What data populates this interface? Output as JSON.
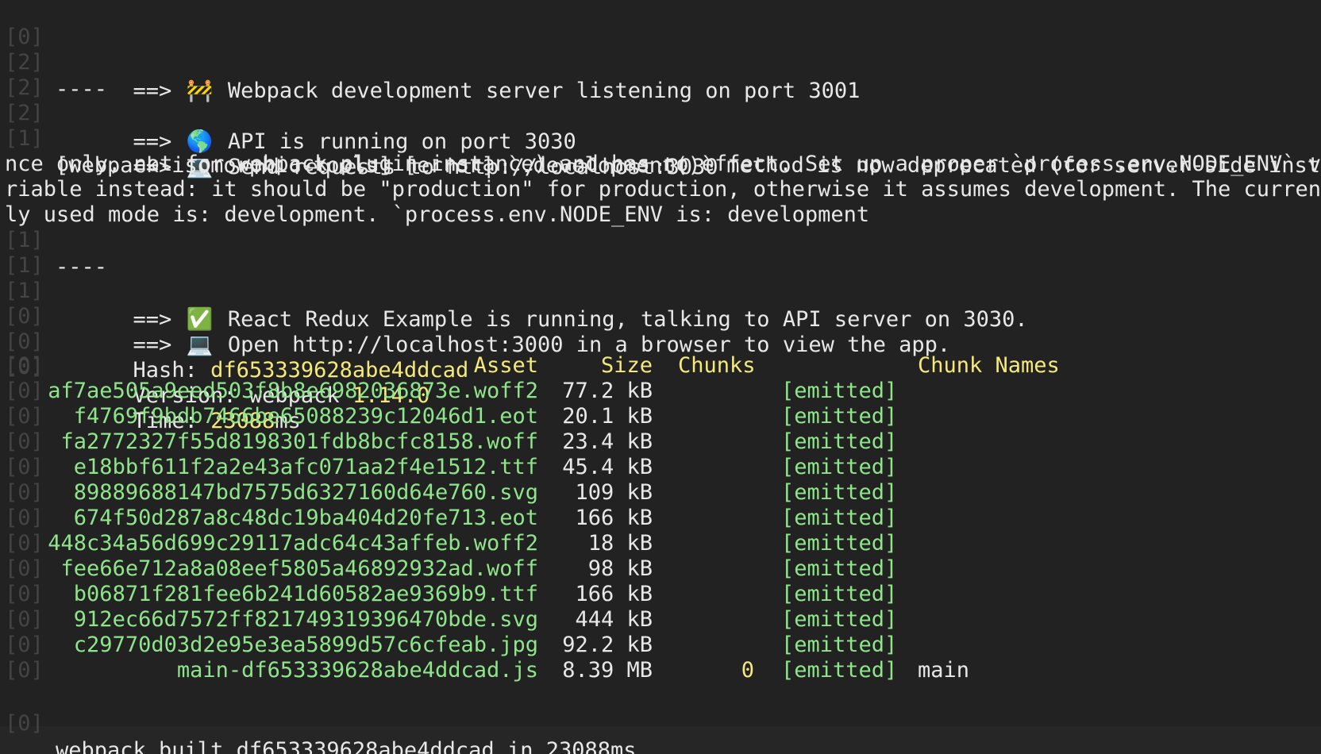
{
  "prefixes": [
    "[0]",
    "[2]",
    "[2]",
    "[2]",
    "[1]",
    "[1]",
    "[1]",
    "[1]",
    "[0]",
    "[0]",
    "[0]",
    "[0]",
    "[0]",
    "[0]",
    "[0]",
    "[0]",
    "[0]",
    "[0]",
    "[0]",
    "[0]",
    "[0]",
    "[0]",
    "[0]",
    "[0]",
    "[0]",
    "[0]",
    "[0]"
  ],
  "lines": {
    "webpack_server": "==> ",
    "webpack_server_emoji": "🚧",
    "webpack_server_text": " Webpack development server listening on port 3001",
    "sep1": "----",
    "api_running_prefix": "==> ",
    "api_running_emoji": "🌎",
    "api_running_text": " API is running on port 3030",
    "send_requests_prefix": "==> ",
    "send_requests_emoji": "💻",
    "send_requests_text": " Send requests to http://localhost:3030",
    "error_line1": "[webpack-isomorphic-tools] [error] `.development()` method is now deprecated (for server-side insta",
    "error_line2": "nce only, not for webpack plugin instance) and has no effect. Set up a proper `process.env.NODE_ENV` va",
    "error_line3": "riable instead: it should be \"production\" for production, otherwise it assumes development. The current",
    "error_line4": "ly used mode is: development. `process.env.NODE_ENV is: development",
    "sep2": "----",
    "react_prefix": "==> ",
    "react_emoji": "✅",
    "react_text": " React Redux Example is running, talking to API server on 3030.",
    "open_prefix": "==> ",
    "open_emoji": "💻",
    "open_text": " Open http://localhost:3000 in a browser to view the app.",
    "hash_label": "Hash: ",
    "hash_value": "df653339628abe4ddcad",
    "version_label": "Version: webpack ",
    "version_value": "1.14.0",
    "time_label": "Time: ",
    "time_value": "23088",
    "time_unit": "ms",
    "built": "webpack built df653339628abe4ddcad in 23088ms"
  },
  "table": {
    "headers": {
      "asset": "Asset",
      "size": "Size",
      "chunks": "Chunks",
      "chunk_names": "Chunk Names"
    },
    "rows": [
      {
        "asset": "af7ae505a9eed503f8b8e6982036873e.woff2",
        "size": "77.2 kB",
        "chunks": "",
        "status": "[emitted]",
        "names": ""
      },
      {
        "asset": "f4769f9bdb7466be65088239c12046d1.eot",
        "size": "20.1 kB",
        "chunks": "",
        "status": "[emitted]",
        "names": ""
      },
      {
        "asset": "fa2772327f55d8198301fdb8bcfc8158.woff",
        "size": "23.4 kB",
        "chunks": "",
        "status": "[emitted]",
        "names": ""
      },
      {
        "asset": "e18bbf611f2a2e43afc071aa2f4e1512.ttf",
        "size": "45.4 kB",
        "chunks": "",
        "status": "[emitted]",
        "names": ""
      },
      {
        "asset": "89889688147bd7575d6327160d64e760.svg",
        "size": "109 kB",
        "chunks": "",
        "status": "[emitted]",
        "names": ""
      },
      {
        "asset": "674f50d287a8c48dc19ba404d20fe713.eot",
        "size": "166 kB",
        "chunks": "",
        "status": "[emitted]",
        "names": ""
      },
      {
        "asset": "448c34a56d699c29117adc64c43affeb.woff2",
        "size": "18 kB",
        "chunks": "",
        "status": "[emitted]",
        "names": ""
      },
      {
        "asset": "fee66e712a8a08eef5805a46892932ad.woff",
        "size": "98 kB",
        "chunks": "",
        "status": "[emitted]",
        "names": ""
      },
      {
        "asset": "b06871f281fee6b241d60582ae9369b9.ttf",
        "size": "166 kB",
        "chunks": "",
        "status": "[emitted]",
        "names": ""
      },
      {
        "asset": "912ec66d7572ff821749319396470bde.svg",
        "size": "444 kB",
        "chunks": "",
        "status": "[emitted]",
        "names": ""
      },
      {
        "asset": "c29770d03d2e95e3ea5899d57c6cfeab.jpg",
        "size": "92.2 kB",
        "chunks": "",
        "status": "[emitted]",
        "names": ""
      },
      {
        "asset": "main-df653339628abe4ddcad.js",
        "size": "8.39 MB",
        "chunks": "0",
        "status": "[emitted]",
        "names": "main"
      }
    ]
  },
  "colors": {
    "background": "#222222",
    "text": "#e8e8e8",
    "yellow": "#f5e97a",
    "green": "#8ee58a",
    "prefix": "#444444"
  }
}
